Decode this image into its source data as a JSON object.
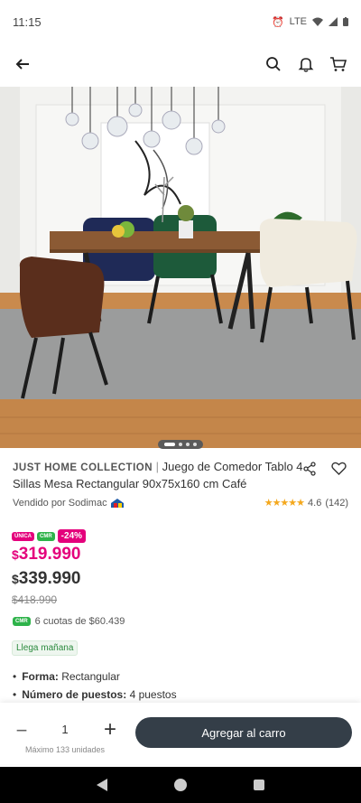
{
  "status_bar": {
    "time": "11:15",
    "network": "LTE"
  },
  "header": {
    "back_icon": "arrow-left-icon",
    "search_icon": "search-icon",
    "bell_icon": "bell-icon",
    "cart_icon": "cart-icon"
  },
  "carousel": {
    "pages": 4,
    "active": 0
  },
  "product": {
    "brand": "JUST HOME COLLECTION",
    "separator": "|",
    "title": "Juego de Comedor Tablo 4 Sillas Mesa Rectangular 90x75x160 cm Café",
    "seller": "Vendido por Sodimac",
    "rating": "4.6",
    "reviews": "(142)",
    "stars": 4.6
  },
  "badges": {
    "unica": "ÚNICA",
    "cmr": "CMR",
    "discount": "-24%"
  },
  "prices": {
    "currency": "$",
    "cmr_price": "319.990",
    "normal_price": "339.990",
    "old_price": "$418.990"
  },
  "cuotas": "6 cuotas de $60.439",
  "delivery": "Llega mañana",
  "specs": [
    {
      "label": "Forma:",
      "value": "Rectangular"
    },
    {
      "label": "Número de puestos:",
      "value": "4 puestos"
    }
  ],
  "cart": {
    "quantity": "1",
    "max_label": "Máximo 133 unidades",
    "add_label": "Agregar al carro"
  },
  "colors": {
    "accent_pink": "#e4007c",
    "cmr_green": "#2eb34a",
    "button_dark": "#343e48",
    "star": "#f4a81d"
  }
}
